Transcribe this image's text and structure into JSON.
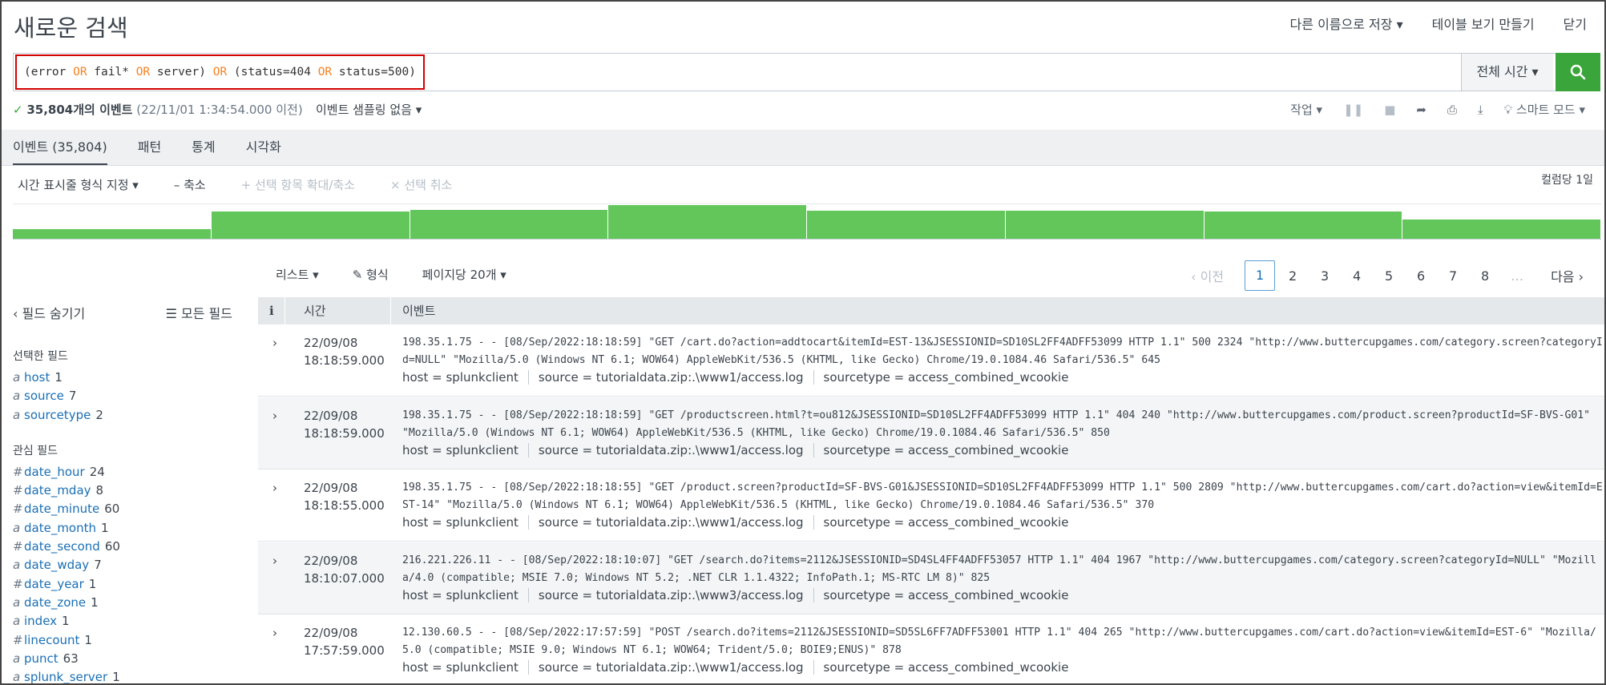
{
  "header": {
    "title": "새로운 검색",
    "save_as": "다른 이름으로 저장 ▾",
    "create_table": "테이블 보기 만들기",
    "close": "닫기"
  },
  "search": {
    "query_parts": [
      {
        "text": "(error ",
        "op": false
      },
      {
        "text": "OR",
        "op": true
      },
      {
        "text": " fail* ",
        "op": false
      },
      {
        "text": "OR",
        "op": true
      },
      {
        "text": " server) ",
        "op": false
      },
      {
        "text": "OR",
        "op": true
      },
      {
        "text": " (status=404 ",
        "op": false
      },
      {
        "text": "OR",
        "op": true
      },
      {
        "text": " status=500)",
        "op": false
      }
    ],
    "time_range": "전체 시간 ▾"
  },
  "status": {
    "check": "✓",
    "count": "35,804개의 이벤트",
    "range": "(22/11/01 1:34:54.000 이전)",
    "sampling": "이벤트 샘플링 없음 ▾",
    "job": "작업 ▾",
    "mode": "스마트 모드 ▾"
  },
  "tabs": [
    {
      "label": "이벤트 (35,804)",
      "active": true
    },
    {
      "label": "패턴",
      "active": false
    },
    {
      "label": "통계",
      "active": false
    },
    {
      "label": "시각화",
      "active": false
    }
  ],
  "timeline": {
    "format": "시간 표시줄 형식 지정 ▾",
    "zoom_out": "– 축소",
    "zoom_selection": "+ 선택 항목 확대/축소",
    "deselect": "× 선택 취소",
    "bucket": "컬럼당 1일",
    "bars": [
      0.27,
      0.78,
      0.82,
      0.95,
      0.8,
      0.8,
      0.78,
      0.55
    ]
  },
  "results_toolbar": {
    "list": "리스트 ▾",
    "format": "✎ 형식",
    "per_page": "페이지당 20개 ▾"
  },
  "pager": {
    "prev": "‹ 이전",
    "pages": [
      "1",
      "2",
      "3",
      "4",
      "5",
      "6",
      "7",
      "8"
    ],
    "current": "1",
    "ellipsis": "…",
    "next": "다음 ›"
  },
  "sidebar": {
    "hide_fields": "‹ 필드 숨기기",
    "all_fields": "☰ 모든 필드",
    "selected_title": "선택한 필드",
    "selected": [
      {
        "type": "a",
        "name": "host",
        "count": "1"
      },
      {
        "type": "a",
        "name": "source",
        "count": "7"
      },
      {
        "type": "a",
        "name": "sourcetype",
        "count": "2"
      }
    ],
    "interesting_title": "관심 필드",
    "interesting": [
      {
        "type": "#",
        "name": "date_hour",
        "count": "24"
      },
      {
        "type": "#",
        "name": "date_mday",
        "count": "8"
      },
      {
        "type": "#",
        "name": "date_minute",
        "count": "60"
      },
      {
        "type": "a",
        "name": "date_month",
        "count": "1"
      },
      {
        "type": "#",
        "name": "date_second",
        "count": "60"
      },
      {
        "type": "a",
        "name": "date_wday",
        "count": "7"
      },
      {
        "type": "#",
        "name": "date_year",
        "count": "1"
      },
      {
        "type": "a",
        "name": "date_zone",
        "count": "1"
      },
      {
        "type": "a",
        "name": "index",
        "count": "1"
      },
      {
        "type": "#",
        "name": "linecount",
        "count": "1"
      },
      {
        "type": "a",
        "name": "punct",
        "count": "63"
      },
      {
        "type": "a",
        "name": "splunk_server",
        "count": "1"
      }
    ]
  },
  "table": {
    "col_info": "i",
    "col_time": "시간",
    "col_event": "이벤트",
    "rows": [
      {
        "date": "22/09/08",
        "time": "18:18:59.000",
        "raw": "198.35.1.75 - - [08/Sep/2022:18:18:59] \"GET /cart.do?action=addtocart&itemId=EST-13&JSESSIONID=SD10SL2FF4ADFF53099 HTTP 1.1\" 500 2324 \"http://www.buttercupgames.com/category.screen?categoryId=NULL\" \"Mozilla/5.0 (Windows NT 6.1; WOW64) AppleWebKit/536.5 (KHTML, like Gecko) Chrome/19.0.1084.46 Safari/536.5\" 645",
        "host": "host = splunkclient",
        "source": "source = tutorialdata.zip:.\\www1/access.log",
        "sourcetype": "sourcetype = access_combined_wcookie"
      },
      {
        "date": "22/09/08",
        "time": "18:18:59.000",
        "raw": "198.35.1.75 - - [08/Sep/2022:18:18:59] \"GET /productscreen.html?t=ou812&JSESSIONID=SD10SL2FF4ADFF53099 HTTP 1.1\" 404 240 \"http://www.buttercupgames.com/product.screen?productId=SF-BVS-G01\" \"Mozilla/5.0 (Windows NT 6.1; WOW64) AppleWebKit/536.5 (KHTML, like Gecko) Chrome/19.0.1084.46 Safari/536.5\" 850",
        "host": "host = splunkclient",
        "source": "source = tutorialdata.zip:.\\www1/access.log",
        "sourcetype": "sourcetype = access_combined_wcookie"
      },
      {
        "date": "22/09/08",
        "time": "18:18:55.000",
        "raw": "198.35.1.75 - - [08/Sep/2022:18:18:55] \"GET /product.screen?productId=SF-BVS-G01&JSESSIONID=SD10SL2FF4ADFF53099 HTTP 1.1\" 500 2809 \"http://www.buttercupgames.com/cart.do?action=view&itemId=EST-14\" \"Mozilla/5.0 (Windows NT 6.1; WOW64) AppleWebKit/536.5 (KHTML, like Gecko) Chrome/19.0.1084.46 Safari/536.5\" 370",
        "host": "host = splunkclient",
        "source": "source = tutorialdata.zip:.\\www1/access.log",
        "sourcetype": "sourcetype = access_combined_wcookie"
      },
      {
        "date": "22/09/08",
        "time": "18:10:07.000",
        "raw": "216.221.226.11 - - [08/Sep/2022:18:10:07] \"GET /search.do?items=2112&JSESSIONID=SD4SL4FF4ADFF53057 HTTP 1.1\" 404 1967 \"http://www.buttercupgames.com/category.screen?categoryId=NULL\" \"Mozilla/4.0 (compatible; MSIE 7.0; Windows NT 5.2; .NET CLR 1.1.4322; InfoPath.1; MS-RTC LM 8)\" 825",
        "host": "host = splunkclient",
        "source": "source = tutorialdata.zip:.\\www3/access.log",
        "sourcetype": "sourcetype = access_combined_wcookie"
      },
      {
        "date": "22/09/08",
        "time": "17:57:59.000",
        "raw": "12.130.60.5 - - [08/Sep/2022:17:57:59] \"POST /search.do?items=2112&JSESSIONID=SD5SL6FF7ADFF53001 HTTP 1.1\" 404 265 \"http://www.buttercupgames.com/cart.do?action=view&itemId=EST-6\" \"Mozilla/5.0 (compatible; MSIE 9.0; Windows NT 6.1; WOW64; Trident/5.0; BOIE9;ENUS)\" 878",
        "host": "host = splunkclient",
        "source": "source = tutorialdata.zip:.\\www1/access.log",
        "sourcetype": "sourcetype = access_combined_wcookie"
      }
    ]
  },
  "colors": {
    "accent_green": "#3aa53a",
    "hist_green": "#62c65b",
    "operator_orange": "#f58220",
    "field_blue": "#1a6fb5",
    "highlight_red": "#d40000"
  }
}
